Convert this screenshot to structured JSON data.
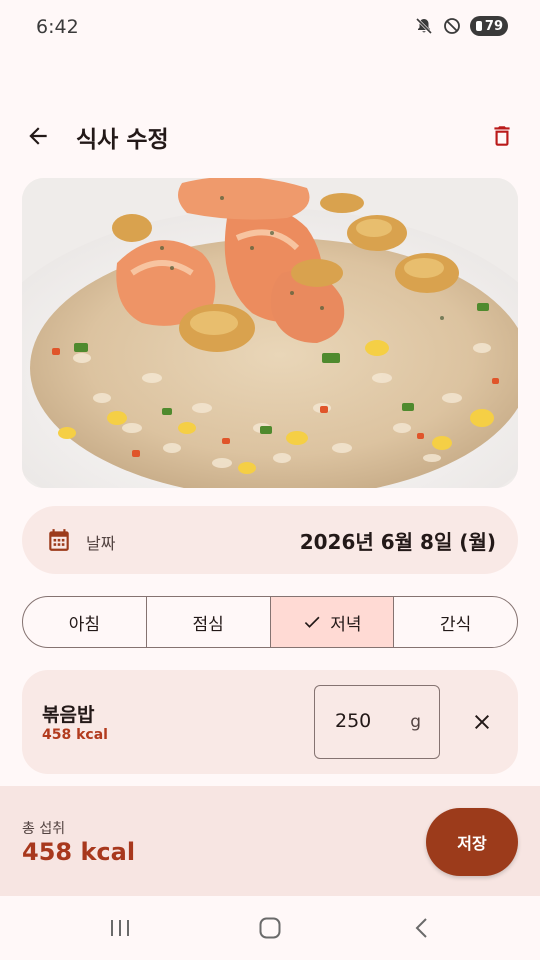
{
  "status_bar": {
    "time": "6:42",
    "battery": "79"
  },
  "app_bar": {
    "title": "식사 수정",
    "back_icon": "arrow-back-icon",
    "delete_icon": "trash-icon"
  },
  "photo": {
    "description_icon": "food-photo"
  },
  "date": {
    "label": "날짜",
    "value": "2026년 6월 8일 (월)",
    "icon": "calendar-icon"
  },
  "meal_types": [
    {
      "label": "아침",
      "selected": false
    },
    {
      "label": "점심",
      "selected": false
    },
    {
      "label": "저녁",
      "selected": true
    },
    {
      "label": "간식",
      "selected": false
    }
  ],
  "food_item": {
    "name": "볶음밥",
    "kcal": "458 kcal",
    "amount": "250",
    "unit": "g"
  },
  "summary": {
    "label": "총 섭취",
    "value": "458 kcal",
    "save_label": "저장"
  },
  "colors": {
    "accent": "#9C3B1B",
    "kcal": "#B23B1E",
    "selected_segment": "#FFDAD4",
    "card": "#F9E9E6"
  }
}
